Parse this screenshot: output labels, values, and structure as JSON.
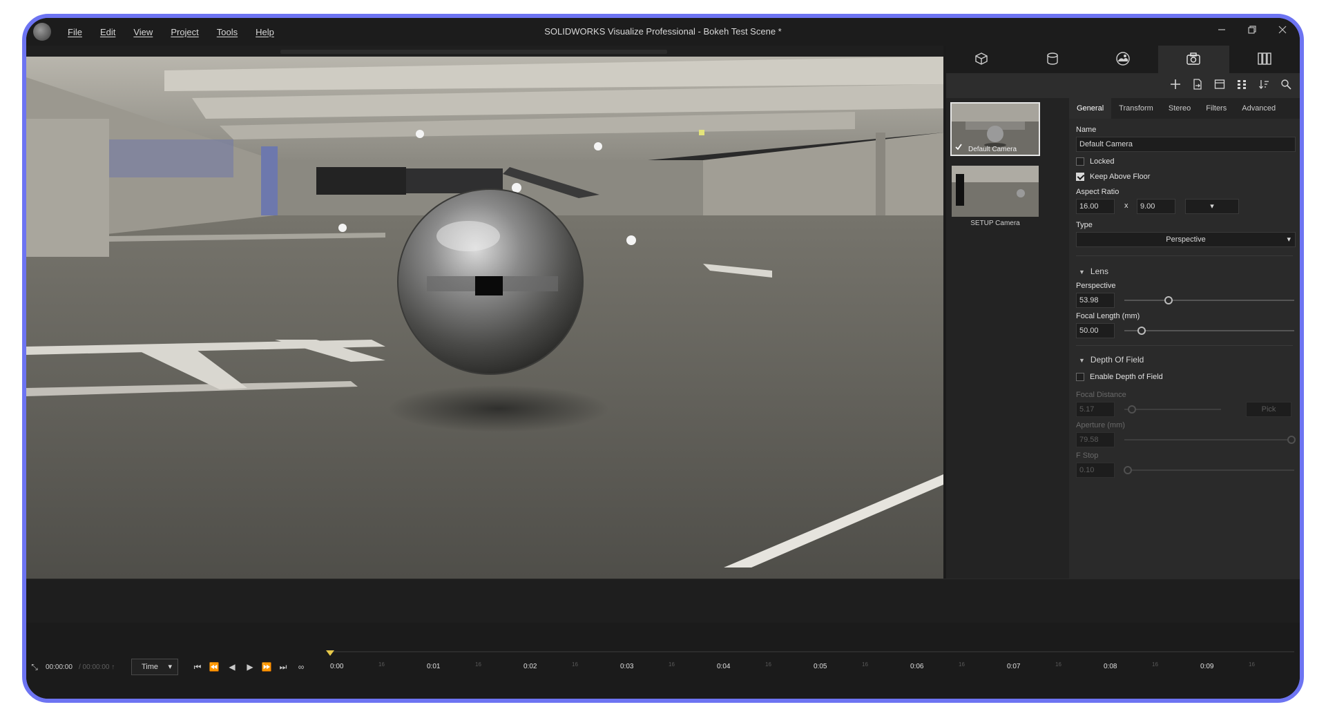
{
  "window": {
    "title": "SOLIDWORKS Visualize Professional - Bokeh Test Scene *",
    "menu": [
      "File",
      "Edit",
      "View",
      "Project",
      "Tools",
      "Help"
    ],
    "logo_icon": "solidworks-visualize-logo-icon"
  },
  "palette_tabs": [
    {
      "icon": "model-cube-icon",
      "active": false
    },
    {
      "icon": "appearances-icon",
      "active": false
    },
    {
      "icon": "scenes-environment-icon",
      "active": false
    },
    {
      "icon": "cameras-icon",
      "active": true
    },
    {
      "icon": "libraries-icon",
      "active": false
    }
  ],
  "panel_toolbar_icons": [
    "add-icon",
    "import-icon",
    "layout-icon",
    "grid-view-icon",
    "sort-icon",
    "search-icon"
  ],
  "cameras": [
    {
      "label": "Default Camera",
      "selected": true
    },
    {
      "label": "SETUP Camera",
      "selected": false
    }
  ],
  "property_tabs": [
    "General",
    "Transform",
    "Stereo",
    "Filters",
    "Advanced"
  ],
  "general": {
    "name_label": "Name",
    "name_value": "Default Camera",
    "locked_label": "Locked",
    "locked": false,
    "keep_above_floor_label": "Keep Above Floor",
    "keep_above_floor": true,
    "aspect_ratio_label": "Aspect Ratio",
    "aspect_w": "16.00",
    "aspect_x": "x",
    "aspect_h": "9.00",
    "type_label": "Type",
    "type_value": "Perspective"
  },
  "lens": {
    "header": "Lens",
    "perspective_label": "Perspective",
    "perspective_value": "53.98",
    "perspective_fraction": 0.26,
    "focal_length_label": "Focal Length (mm)",
    "focal_length_value": "50.00",
    "focal_length_fraction": 0.1
  },
  "dof": {
    "header": "Depth Of Field",
    "enable_label": "Enable Depth of Field",
    "enabled": false,
    "focal_distance_label": "Focal Distance",
    "focal_distance_value": "5.17",
    "focal_distance_fraction": 0.08,
    "pick_label": "Pick",
    "aperture_label": "Aperture (mm)",
    "aperture_value": "79.58",
    "aperture_fraction": 1.0,
    "fstop_label": "F Stop",
    "fstop_value": "0.10",
    "fstop_fraction": 0.02
  },
  "timeline": {
    "time_current": "00:00:00",
    "time_total": "/ 00:00:00 ↑",
    "mode_select": "Time",
    "transport_icons": [
      "skip-start-icon",
      "prev-keyframe-icon",
      "play-reverse-icon",
      "play-icon",
      "next-keyframe-icon",
      "skip-end-icon",
      "loop-icon"
    ],
    "ticks": [
      "0:00",
      "0:01",
      "0:02",
      "0:03",
      "0:04",
      "0:05",
      "0:06",
      "0:07",
      "0:08",
      "0:09"
    ],
    "minor_tick": "16"
  }
}
